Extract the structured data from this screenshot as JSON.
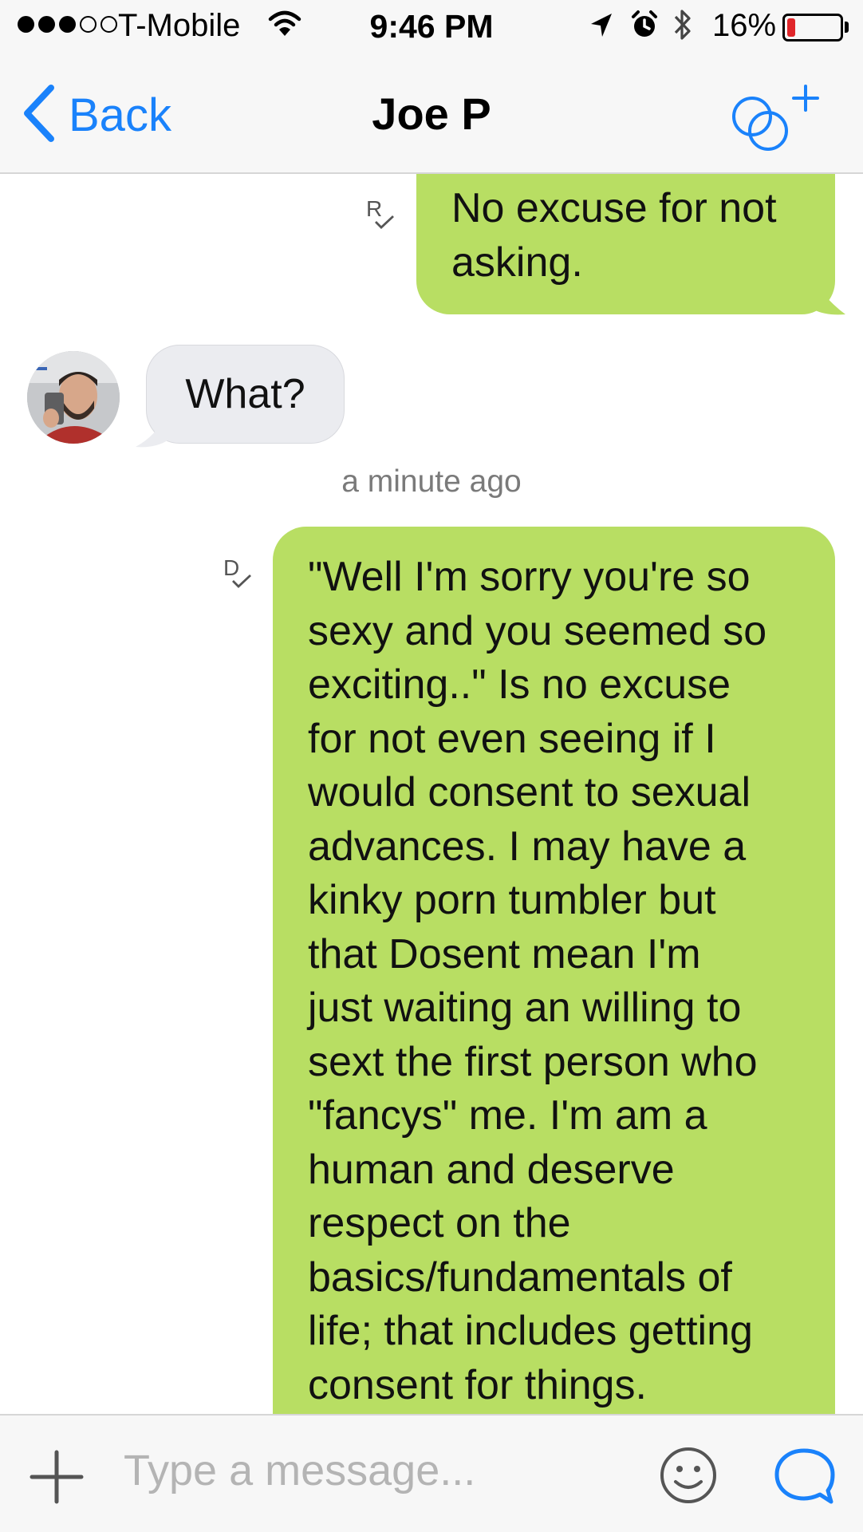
{
  "status_bar": {
    "carrier": "T-Mobile",
    "time": "9:46 PM",
    "battery_percent": "16%",
    "battery_level": 0.16,
    "signal_bars": 3,
    "signal_total": 5,
    "icons": [
      "wifi-icon",
      "location-arrow-icon",
      "alarm-clock-icon",
      "bluetooth-icon",
      "battery-icon"
    ]
  },
  "nav": {
    "back_label": "Back",
    "title": "Joe P",
    "right_icon": "add-to-group-icon"
  },
  "messages": [
    {
      "direction": "outgoing",
      "text": "No excuse for not asking.",
      "lines": [
        "No excuse for not",
        "asking."
      ],
      "receipt": "R"
    },
    {
      "direction": "incoming",
      "text": "What?",
      "avatar": "avatar"
    },
    {
      "type": "timestamp",
      "text": "a minute ago"
    },
    {
      "direction": "outgoing",
      "receipt": "D",
      "text": "\"Well I'm sorry you're so sexy and you seemed so exciting..\" Is no excuse for not even seeing if I would consent to sexual advances. I may have a kinky porn tumbler but that Dosent mean I'm just waiting an willing to sext the first person who \"fancys\" me. I'm am a human and deserve respect on the basics/fundamentals of life; that includes getting consent for things.",
      "lines": [
        "\"Well I'm sorry you're so",
        "sexy and you seemed so",
        "exciting..\" Is no excuse",
        "for not even seeing if I",
        "would consent to sexual",
        "advances. I may have a",
        "kinky porn tumbler but",
        "that Dosent mean I'm",
        "just waiting an willing to",
        "sext the first person who",
        "\"fancys\" me. I'm am a",
        "human and deserve",
        "respect on the",
        "basics/fundamentals of",
        "life; that includes getting",
        "consent for things."
      ]
    }
  ],
  "input": {
    "placeholder": "Type a message...",
    "icons": [
      "plus-icon",
      "emoji-icon",
      "chat-bubble-icon"
    ]
  },
  "colors": {
    "accent": "#1a82fb",
    "outgoing_bubble": "#b8de63",
    "incoming_bubble": "#ebecf0",
    "battery_low": "#e0262a"
  }
}
